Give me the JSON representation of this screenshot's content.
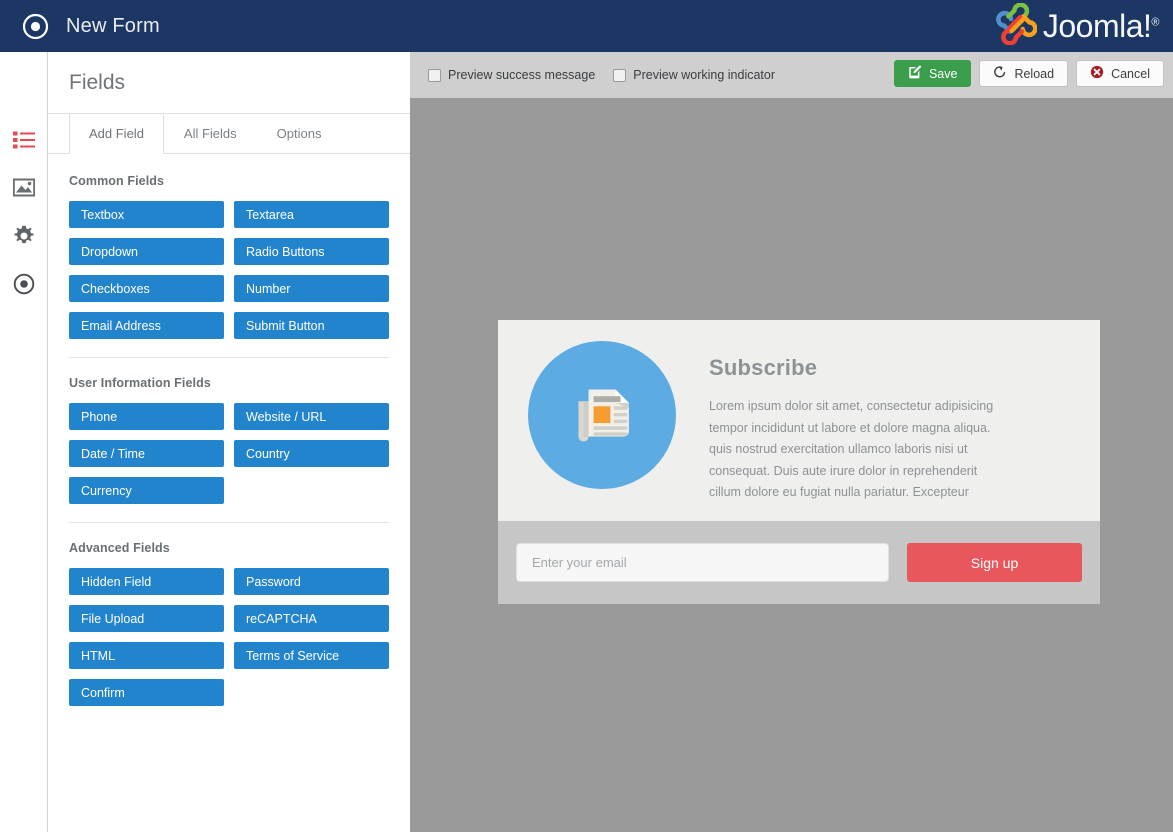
{
  "header": {
    "title": "New Form",
    "circle_icon": "target-circle-icon",
    "brand": "Joomla!",
    "brand_trademark": "®",
    "bg_color": "#1c3764"
  },
  "icon_rail": {
    "items": [
      {
        "name": "sidebar-item-fields",
        "icon": "list-icon",
        "active": true,
        "color": "#e8484f"
      },
      {
        "name": "sidebar-item-media",
        "icon": "image-icon",
        "active": false,
        "color": "#6a6f73"
      },
      {
        "name": "sidebar-item-settings",
        "icon": "gear-icon",
        "active": false,
        "color": "#6a6f73"
      },
      {
        "name": "sidebar-item-publish",
        "icon": "target-circle-icon",
        "active": false,
        "color": "#4a4e52"
      }
    ]
  },
  "fields_panel": {
    "title": "Fields",
    "tabs": [
      {
        "label": "Add Field",
        "active": true
      },
      {
        "label": "All Fields",
        "active": false
      },
      {
        "label": "Options",
        "active": false
      }
    ],
    "groups": [
      {
        "title": "Common Fields",
        "buttons": [
          "Textbox",
          "Textarea",
          "Dropdown",
          "Radio Buttons",
          "Checkboxes",
          "Number",
          "Email Address",
          "Submit Button"
        ]
      },
      {
        "title": "User Information Fields",
        "buttons": [
          "Phone",
          "Website / URL",
          "Date / Time",
          "Country",
          "Currency"
        ]
      },
      {
        "title": "Advanced Fields",
        "buttons": [
          "Hidden Field",
          "Password",
          "File Upload",
          "reCAPTCHA",
          "HTML",
          "Terms of Service",
          "Confirm"
        ]
      }
    ],
    "button_color": "#2384ce"
  },
  "preview_toolbar": {
    "checkboxes": [
      {
        "label": "Preview success message",
        "checked": false
      },
      {
        "label": "Preview working indicator",
        "checked": false
      }
    ],
    "buttons": [
      {
        "label": "Save",
        "icon": "edit-pencil-square-icon",
        "style": "primary",
        "color": "#3b9e4d"
      },
      {
        "label": "Reload",
        "icon": "refresh-arrow-icon",
        "style": "plain"
      },
      {
        "label": "Cancel",
        "icon": "cancel-circle-x-icon",
        "style": "plain",
        "icon_color": "#a02128"
      }
    ],
    "bg_color": "#cfcfcf"
  },
  "preview": {
    "stage_bg_color": "#9a9a9a",
    "card": {
      "heading": "Subscribe",
      "body": "Lorem ipsum dolor sit amet, consectetur adipisicing tempor incididunt ut labore et dolore magna aliqua. quis nostrud exercitation ullamco laboris nisi ut consequat. Duis aute irure dolor in reprehenderit cillum dolore eu fugiat nulla pariatur. Excepteur",
      "illustration_icon": "newspaper-document-icon",
      "illustration_bg_color": "#5dabe3",
      "email_placeholder": "Enter your email",
      "email_value": "",
      "signup_label": "Sign up",
      "signup_color": "#e8575c",
      "card_bg_color": "#efefee",
      "footer_bg_color": "#c6c6c6"
    }
  }
}
